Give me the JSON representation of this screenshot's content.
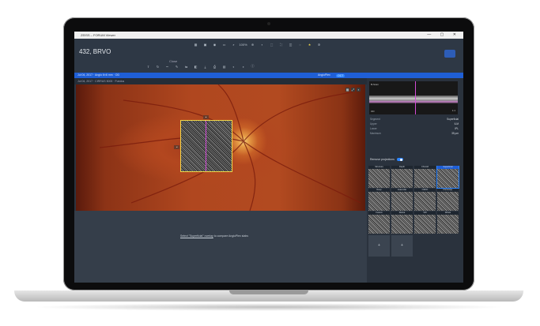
{
  "window": {
    "title": "ZEISS – FORUM Viewer",
    "controls": "— ▢ ✕"
  },
  "patient": {
    "title": "432, BRVO"
  },
  "header": {
    "close_label": "Close"
  },
  "toolbar": {
    "icons": [
      "grid-icon",
      "layout-icon",
      "eye-icon",
      "display-icon",
      "zoom-icon",
      "zoom-level",
      "zoom-in-icon",
      "lock-icon",
      "fit-icon",
      "fullscreen-icon",
      "crop-icon",
      "measure-icon",
      "star-icon",
      "settings-icon"
    ],
    "zoom_value": "100%"
  },
  "bluebar": {
    "left_text": "Jul 04, 2017  ·  Angio 6×6 mm  ·  OD",
    "right_text": "AngioPlex",
    "badge": "OCT"
  },
  "subbar": {
    "text": "Jul 04, 2017  ·  CIRRUS 5000  ·  Fundus"
  },
  "fundus": {
    "tool_icons": [
      "grid-icon",
      "expand-icon",
      "lock-icon"
    ]
  },
  "lower": {
    "message_link": "Select \"Superficial\" overlay",
    "message_rest": "to compare AngioPlex slabs"
  },
  "rpanel": {
    "bscan_label": "B-Scan",
    "bscan_tag": "OD",
    "bscan_zoom": "1:1",
    "params": [
      {
        "label": "Segment",
        "value": "Superficial"
      },
      {
        "label": "Upper",
        "value": "ILM"
      },
      {
        "label": "Lower",
        "value": "IPL"
      },
      {
        "label": "Maximum",
        "value": "35 µm"
      }
    ],
    "projection_label": "Remove projections",
    "thumbs": [
      {
        "cap": "Structure",
        "sel": false
      },
      {
        "cap": "Depth",
        "sel": false
      },
      {
        "cap": "Choroid",
        "sel": false
      },
      {
        "cap": "Superficial",
        "sel": true
      },
      {
        "cap": "Deep",
        "sel": false
      },
      {
        "cap": "Avascular",
        "sel": false
      },
      {
        "cap": "ORCC",
        "sel": false
      },
      {
        "cap": "Choriocap.",
        "sel": false
      },
      {
        "cap": "Custom",
        "sel": false
      },
      {
        "cap": "Retina",
        "sel": false
      },
      {
        "cap": "VRI",
        "sel": false
      },
      {
        "cap": "Whole",
        "sel": false
      }
    ],
    "add_buttons": [
      "+",
      "+"
    ]
  }
}
